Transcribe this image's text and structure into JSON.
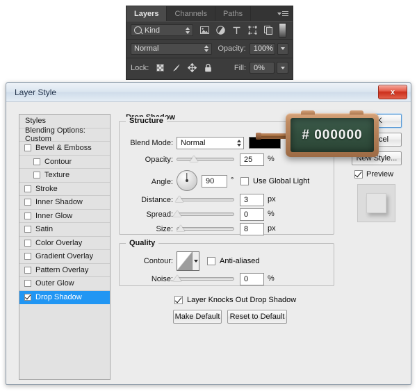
{
  "layers_panel": {
    "tabs": [
      {
        "label": "Layers",
        "active": true
      },
      {
        "label": "Channels",
        "active": false
      },
      {
        "label": "Paths",
        "active": false
      }
    ],
    "menu_icon": "panel-menu-icon",
    "filter": {
      "search_icon": "search-icon",
      "kind_label": "Kind",
      "type_icons": [
        "image-filter-icon",
        "adjustment-filter-icon",
        "type-filter-icon",
        "shape-filter-icon",
        "smartobject-filter-icon"
      ]
    },
    "blend": {
      "mode": "Normal",
      "opacity_label": "Opacity:",
      "opacity_value": "100%"
    },
    "lock": {
      "label": "Lock:",
      "icons": [
        "lock-transparent-pixels-icon",
        "lock-image-pixels-icon",
        "lock-position-icon",
        "lock-all-icon"
      ],
      "fill_label": "Fill:",
      "fill_value": "0%"
    }
  },
  "dialog": {
    "title": "Layer Style",
    "close_label": "x",
    "styles": {
      "header": "Styles",
      "blending_options": "Blending Options: Custom",
      "items": [
        {
          "label": "Bevel & Emboss",
          "checked": false,
          "indent": false,
          "selected": false
        },
        {
          "label": "Contour",
          "checked": false,
          "indent": true,
          "selected": false
        },
        {
          "label": "Texture",
          "checked": false,
          "indent": true,
          "selected": false
        },
        {
          "label": "Stroke",
          "checked": false,
          "indent": false,
          "selected": false
        },
        {
          "label": "Inner Shadow",
          "checked": false,
          "indent": false,
          "selected": false
        },
        {
          "label": "Inner Glow",
          "checked": false,
          "indent": false,
          "selected": false
        },
        {
          "label": "Satin",
          "checked": false,
          "indent": false,
          "selected": false
        },
        {
          "label": "Color Overlay",
          "checked": false,
          "indent": false,
          "selected": false
        },
        {
          "label": "Gradient Overlay",
          "checked": false,
          "indent": false,
          "selected": false
        },
        {
          "label": "Pattern Overlay",
          "checked": false,
          "indent": false,
          "selected": false
        },
        {
          "label": "Outer Glow",
          "checked": false,
          "indent": false,
          "selected": false
        },
        {
          "label": "Drop Shadow",
          "checked": true,
          "indent": false,
          "selected": true
        }
      ]
    },
    "drop_shadow": {
      "group_title": "Drop Shadow",
      "structure_title": "Structure",
      "blend_mode_label": "Blend Mode:",
      "blend_mode_value": "Normal",
      "color_swatch": "#000000",
      "opacity_label": "Opacity:",
      "opacity_value": "25",
      "opacity_unit": "%",
      "angle_label": "Angle:",
      "angle_value": "90",
      "angle_unit": "°",
      "use_global_light": "Use Global Light",
      "use_global_light_checked": false,
      "distance_label": "Distance:",
      "distance_value": "3",
      "distance_unit": "px",
      "spread_label": "Spread:",
      "spread_value": "0",
      "spread_unit": "%",
      "size_label": "Size:",
      "size_value": "8",
      "size_unit": "px"
    },
    "quality": {
      "group_title": "Quality",
      "contour_label": "Contour:",
      "anti_aliased_label": "Anti-aliased",
      "anti_aliased_checked": false,
      "noise_label": "Noise:",
      "noise_value": "0",
      "noise_unit": "%"
    },
    "footer": {
      "knocks_out_label": "Layer Knocks Out Drop Shadow",
      "knocks_out_checked": true,
      "make_default": "Make Default",
      "reset_to_default": "Reset to Default"
    },
    "right_buttons": {
      "ok": "OK",
      "cancel": "Cancel",
      "new_style": "New Style...",
      "preview_label": "Preview",
      "preview_checked": true
    }
  },
  "callout": {
    "chalkboard_text": "# 000000"
  }
}
